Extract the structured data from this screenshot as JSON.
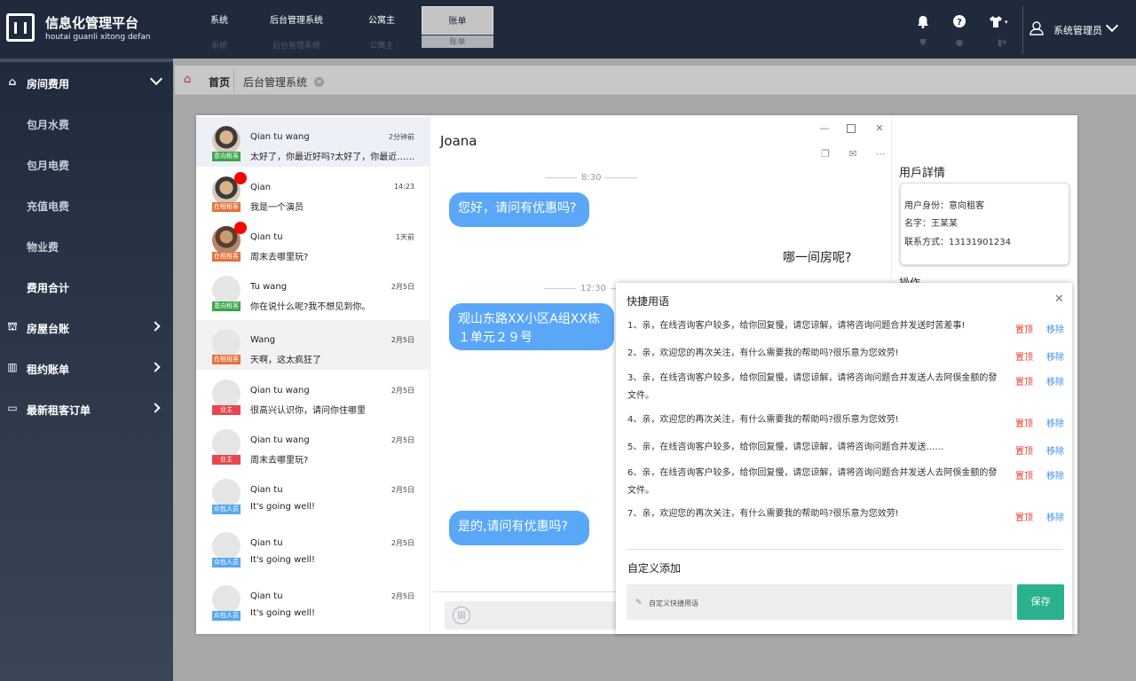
{
  "app": {
    "title": "信息化管理平台",
    "subtitle": "houtai guanli xitong defan"
  },
  "topnav": [
    {
      "label": "系统",
      "ghost": "系统"
    },
    {
      "label": "后台管理系统",
      "ghost": "后台管理系统"
    },
    {
      "label": "公寓主",
      "ghost": "公寓主"
    },
    {
      "label": "账单",
      "ghost": "账单",
      "active": true
    }
  ],
  "top_icons": [
    "bell-icon",
    "help-icon",
    "shirt-icon"
  ],
  "user": {
    "name": "系统管理员"
  },
  "sidebar": {
    "open_group": "房间费用",
    "sub_items": [
      "包月水费",
      "包月电费",
      "充值电费",
      "物业费",
      "费用合计"
    ],
    "active_sub": "费用合计",
    "groups": [
      "房屋台账",
      "租约账单",
      "最新租客订单"
    ]
  },
  "tabs": {
    "home": "首页",
    "current": "后台管理系统"
  },
  "conversations": [
    {
      "name": "Qian tu wang",
      "time": "2分钟前",
      "msg": "太好了，你最近好吗?太好了，你最近……",
      "badge": "意向租客",
      "badge_color": "#3aa54a"
    },
    {
      "name": "Qian",
      "time": "14:23",
      "msg": "我是一个演员",
      "badge": "在租租客",
      "badge_color": "#e6723c",
      "unread": true
    },
    {
      "name": "Qian tu",
      "time": "1天前",
      "msg": "周末去哪里玩?",
      "badge": "在租租客",
      "badge_color": "#e6723c",
      "unread": true
    },
    {
      "name": "Tu wang",
      "time": "2月5日",
      "msg": "你在说什么呢?我不想见到你。",
      "badge": "意向租客",
      "badge_color": "#3aa54a"
    },
    {
      "name": "Wang",
      "time": "2月5日",
      "msg": "天啊，这太疯狂了",
      "badge": "在租租客",
      "badge_color": "#e6723c"
    },
    {
      "name": "Qian tu wang",
      "time": "2月5日",
      "msg": "很高兴认识你，请问你住哪里",
      "badge": "业主",
      "badge_color": "#e5474d"
    },
    {
      "name": "Qian tu wang",
      "time": "2月5日",
      "msg": "周末去哪里玩?",
      "badge": "业主",
      "badge_color": "#e5474d"
    },
    {
      "name": "Qian tu",
      "time": "2月5日",
      "msg": "It's going well!",
      "badge": "众包人员",
      "badge_color": "#5aa7f0"
    },
    {
      "name": "Qian tu",
      "time": "2月5日",
      "msg": "It's going well!",
      "badge": "众包人员",
      "badge_color": "#5aa7f0"
    },
    {
      "name": "Qian tu",
      "time": "2月5日",
      "msg": "It's going well!",
      "badge": "众包人员",
      "badge_color": "#5aa7f0"
    }
  ],
  "chat": {
    "contact": "Joana",
    "time1": "8:30",
    "msg1": "您好，请问有优惠吗?",
    "reply1": "哪一间房呢?",
    "time2": "12:30",
    "msg2_line1": "观山东路XX小区A组XX栋",
    "msg2_line2": "１单元２９号",
    "msg3": "是的,请问有优惠吗?"
  },
  "user_detail": {
    "title": "用戶詳情",
    "identity": "用户身份：意向租客",
    "name": "名字：王某某",
    "contact": "联系方式：13131901234",
    "section_cut": "操作"
  },
  "quick_replies": {
    "title": "快捷用语",
    "pin_label": "置顶",
    "remove_label": "移除",
    "items": [
      "1、亲，在线咨询客户较多，给你回复慢，请您谅解，请将咨询问题合并发送时苦差事!",
      "2、亲，欢迎您的再次关注，有什么需要我的帮助吗?很乐意为您效劳!",
      "3、亲，在线咨询客户较多，给你回复慢，请您谅解，请将咨询问题合并发送人去阿俁金额的發文件。",
      "4、亲，欢迎您的再次关注，有什么需要我的帮助吗?很乐意为您效劳!",
      "5、亲，在线咨询客户较多，给你回复慢，请您谅解，请将咨询问题合并发送……",
      "6、亲，在线咨询客户较多，给你回复慢，请您谅解，请将咨询问题合并发送人去阿俁金额的發文件。",
      "7、亲，欢迎您的再次关注，有什么需要我的帮助吗?很乐意为您效劳!"
    ],
    "custom_title": "自定义添加",
    "custom_placeholder": "自定义快捷用语",
    "save_label": "保存"
  }
}
